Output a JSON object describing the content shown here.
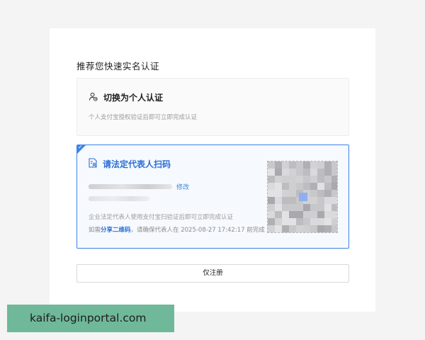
{
  "heading": "推荐您快速实名认证",
  "personal_option": {
    "icon": "person-switch-icon",
    "title": "切换为个人认证",
    "description": "个人支付宝授权验证后即可立即完成认证"
  },
  "legal_option": {
    "icon": "document-person-icon",
    "title": "请法定代表人扫码",
    "edit_label": "修改",
    "description": "企业法定代表人使用支付宝扫验证后即可立即完成认证",
    "share_prefix": "如需",
    "share_link": "分享二维码",
    "share_suffix": "，请确保代表人在 2025-08-27 17:42:17 前完成",
    "selected": true
  },
  "qr_code": {
    "icon": "qr-code-icon"
  },
  "register_button": "仅注册",
  "watermark": "kaifa-loginportal.com",
  "colors": {
    "accent": "#3c84e6",
    "watermark_bg": "#6fb89a"
  }
}
